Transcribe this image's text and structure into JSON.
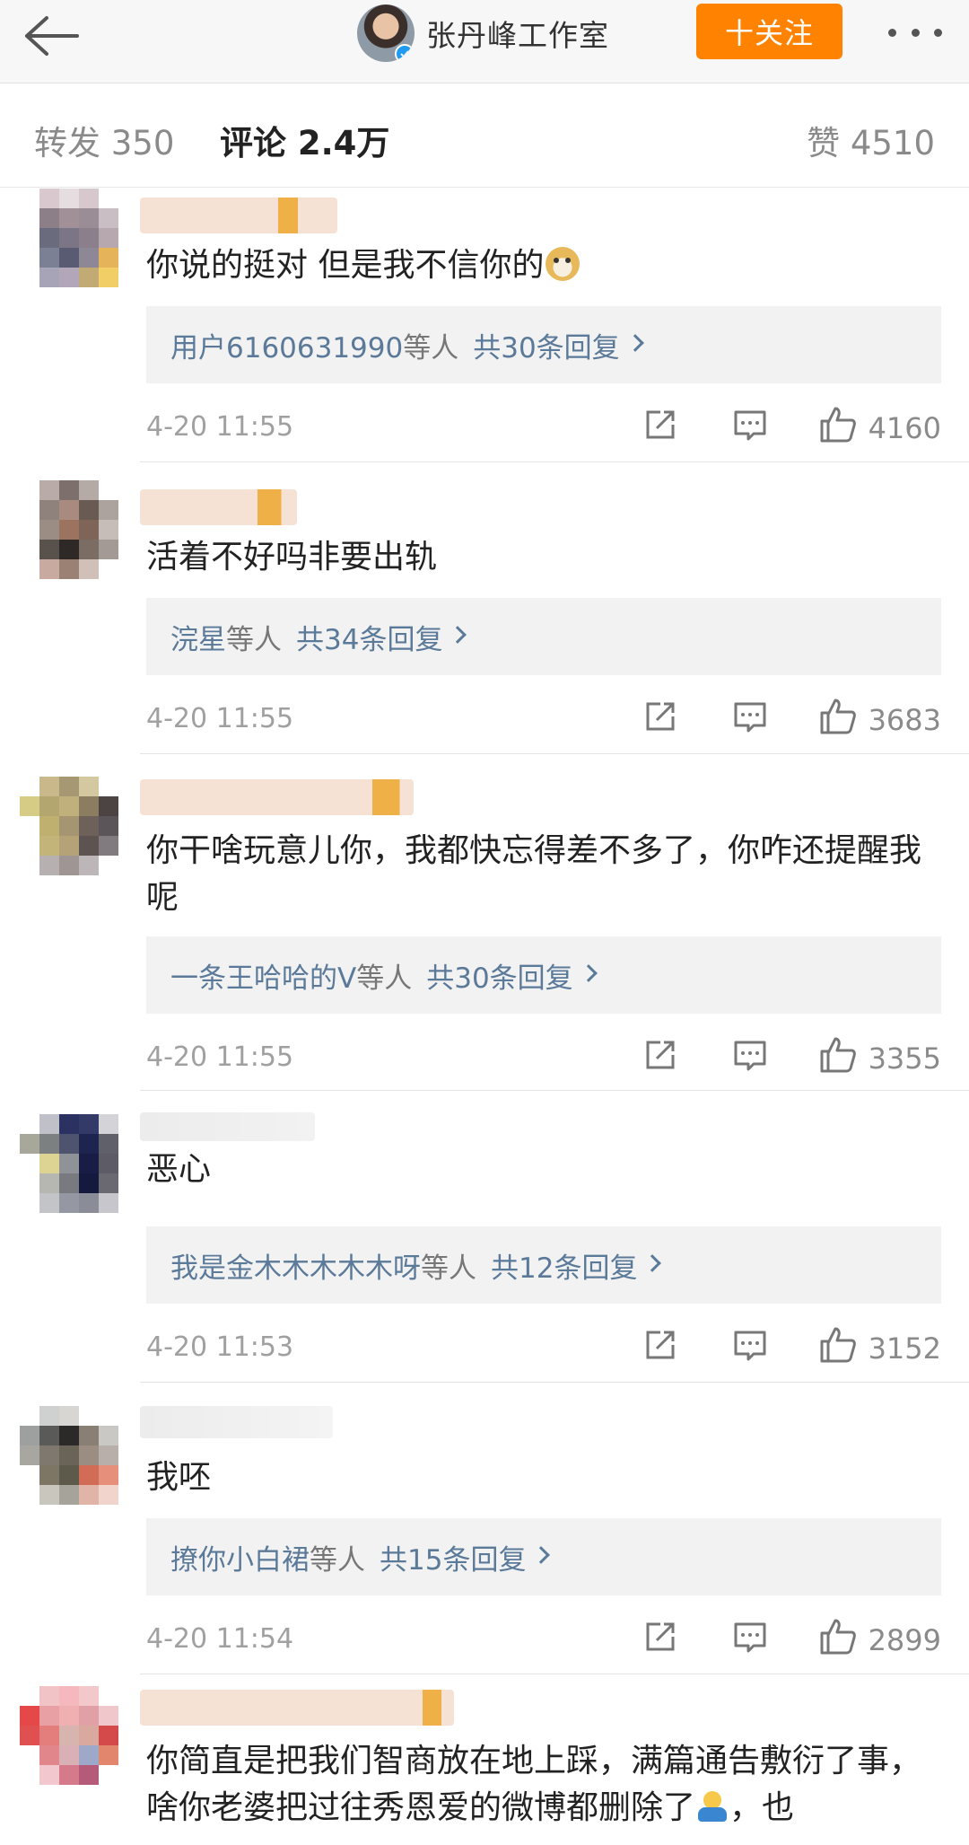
{
  "header": {
    "back_icon": "arrow-left-icon",
    "title": "张丹峰工作室",
    "follow_label": "十关注",
    "more_icon": "more-dots-icon",
    "accent": "#ff8200"
  },
  "tabs": {
    "repost": "转发 350",
    "comments": "评论 2.4万",
    "likes": "赞 4510"
  },
  "comments": [
    {
      "text": "你说的挺对 但是我不信你的",
      "emoji": "doge-emoji",
      "reply_users": "用户6160631990",
      "reply_suffix": "等人",
      "reply_count": "共30条回复",
      "time": "4-20 11:55",
      "likes": "4160"
    },
    {
      "text": "活着不好吗非要出轨",
      "reply_users": "浣星",
      "reply_suffix": "等人",
      "reply_count": "共34条回复",
      "time": "4-20 11:55",
      "likes": "3683"
    },
    {
      "text": "你干啥玩意儿你，我都快忘得差不多了，你咋还提醒我呢",
      "reply_users": "一条王哈哈的V",
      "reply_suffix": "等人",
      "reply_count": "共30条回复",
      "time": "4-20 11:55",
      "likes": "3355"
    },
    {
      "text": "恶心",
      "reply_users": "我是金木木木木木呀",
      "reply_suffix": "等人",
      "reply_count": "共12条回复",
      "time": "4-20 11:53",
      "likes": "3152"
    },
    {
      "text": "我呸",
      "reply_users": "撩你小白裙",
      "reply_suffix": "等人",
      "reply_count": "共15条回复",
      "time": "4-20 11:54",
      "likes": "2899"
    },
    {
      "text": "你简直是把我们智商放在地上踩，满篇通告敷衍了事，啥你老婆把过往秀恩爱的微博都删除了",
      "text_tail": "，也",
      "emoji": "shrug-emoji"
    }
  ]
}
